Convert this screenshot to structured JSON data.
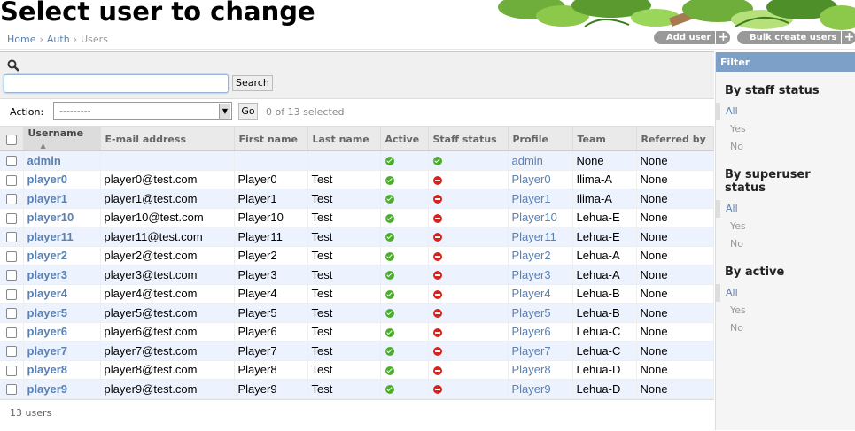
{
  "page": {
    "title": "Select user to change"
  },
  "breadcrumb": {
    "home": "Home",
    "auth": "Auth",
    "current": "Users",
    "sep": "›"
  },
  "tools": {
    "add_user": "Add user",
    "bulk_create": "Bulk create users",
    "plus": "+"
  },
  "search": {
    "value": "",
    "button": "Search"
  },
  "actions": {
    "label": "Action:",
    "selected_option": "---------",
    "go": "Go",
    "counter": "0 of 13 selected"
  },
  "table": {
    "headers": [
      "Username",
      "E-mail address",
      "First name",
      "Last name",
      "Active",
      "Staff status",
      "Profile",
      "Team",
      "Referred by"
    ],
    "rows": [
      {
        "username": "admin",
        "email": "",
        "first": "",
        "last": "",
        "active": true,
        "staff": true,
        "profile": "admin",
        "team": "None",
        "referred": "None"
      },
      {
        "username": "player0",
        "email": "player0@test.com",
        "first": "Player0",
        "last": "Test",
        "active": true,
        "staff": false,
        "profile": "Player0",
        "team": "Ilima-A",
        "referred": "None"
      },
      {
        "username": "player1",
        "email": "player1@test.com",
        "first": "Player1",
        "last": "Test",
        "active": true,
        "staff": false,
        "profile": "Player1",
        "team": "Ilima-A",
        "referred": "None"
      },
      {
        "username": "player10",
        "email": "player10@test.com",
        "first": "Player10",
        "last": "Test",
        "active": true,
        "staff": false,
        "profile": "Player10",
        "team": "Lehua-E",
        "referred": "None"
      },
      {
        "username": "player11",
        "email": "player11@test.com",
        "first": "Player11",
        "last": "Test",
        "active": true,
        "staff": false,
        "profile": "Player11",
        "team": "Lehua-E",
        "referred": "None"
      },
      {
        "username": "player2",
        "email": "player2@test.com",
        "first": "Player2",
        "last": "Test",
        "active": true,
        "staff": false,
        "profile": "Player2",
        "team": "Lehua-A",
        "referred": "None"
      },
      {
        "username": "player3",
        "email": "player3@test.com",
        "first": "Player3",
        "last": "Test",
        "active": true,
        "staff": false,
        "profile": "Player3",
        "team": "Lehua-A",
        "referred": "None"
      },
      {
        "username": "player4",
        "email": "player4@test.com",
        "first": "Player4",
        "last": "Test",
        "active": true,
        "staff": false,
        "profile": "Player4",
        "team": "Lehua-B",
        "referred": "None"
      },
      {
        "username": "player5",
        "email": "player5@test.com",
        "first": "Player5",
        "last": "Test",
        "active": true,
        "staff": false,
        "profile": "Player5",
        "team": "Lehua-B",
        "referred": "None"
      },
      {
        "username": "player6",
        "email": "player6@test.com",
        "first": "Player6",
        "last": "Test",
        "active": true,
        "staff": false,
        "profile": "Player6",
        "team": "Lehua-C",
        "referred": "None"
      },
      {
        "username": "player7",
        "email": "player7@test.com",
        "first": "Player7",
        "last": "Test",
        "active": true,
        "staff": false,
        "profile": "Player7",
        "team": "Lehua-C",
        "referred": "None"
      },
      {
        "username": "player8",
        "email": "player8@test.com",
        "first": "Player8",
        "last": "Test",
        "active": true,
        "staff": false,
        "profile": "Player8",
        "team": "Lehua-D",
        "referred": "None"
      },
      {
        "username": "player9",
        "email": "player9@test.com",
        "first": "Player9",
        "last": "Test",
        "active": true,
        "staff": false,
        "profile": "Player9",
        "team": "Lehua-D",
        "referred": "None"
      }
    ],
    "icons": {
      "yes": "green-check-icon",
      "no": "red-no-icon"
    },
    "count_text": "13 users"
  },
  "filter": {
    "title": "Filter",
    "groups": [
      {
        "heading": "By staff status",
        "options": [
          "All",
          "Yes",
          "No"
        ],
        "selected": "All"
      },
      {
        "heading": "By superuser status",
        "options": [
          "All",
          "Yes",
          "No"
        ],
        "selected": "All"
      },
      {
        "heading": "By active",
        "options": [
          "All",
          "Yes",
          "No"
        ],
        "selected": "All"
      }
    ]
  },
  "colors": {
    "link": "#5b80b2",
    "row_alt": "#edf3fe",
    "filter_header": "#7ca0c7",
    "yes": "#4cae2c",
    "no": "#d9221a"
  }
}
